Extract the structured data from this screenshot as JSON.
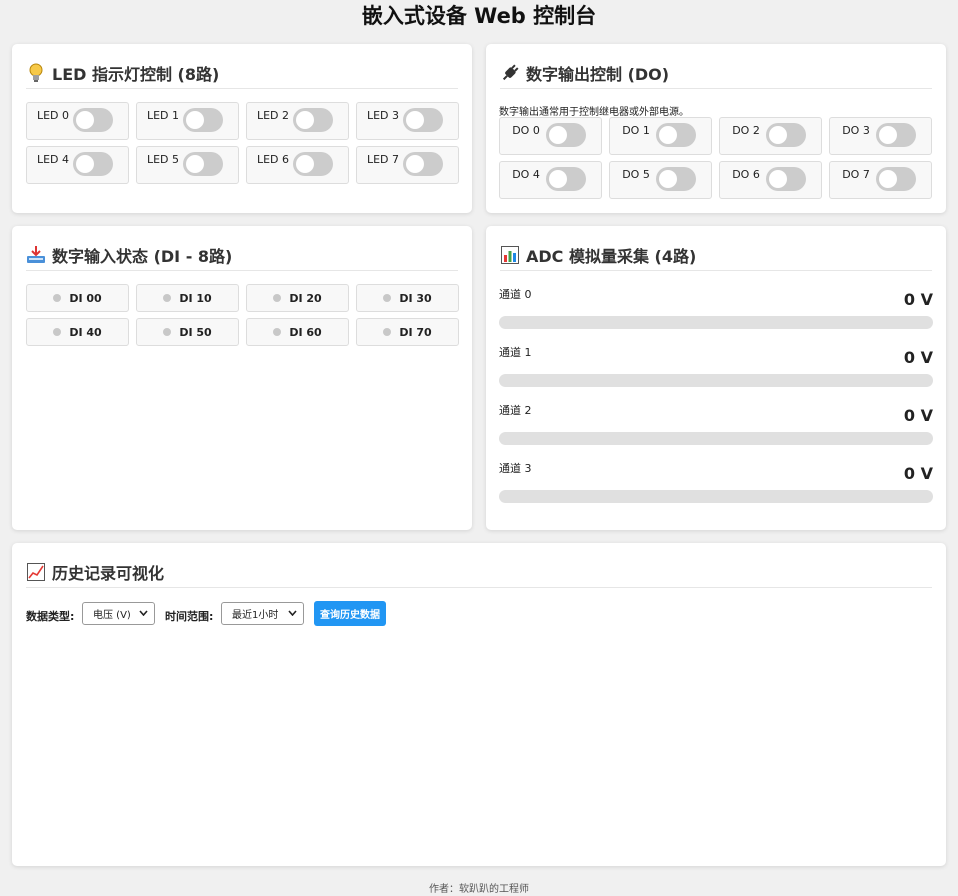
{
  "title": "嵌入式设备 Web 控制台",
  "led_panel": {
    "title": "LED 指示灯控制 (8路)",
    "icon": "lightbulb-icon",
    "items": [
      {
        "label": "LED 0",
        "on": false
      },
      {
        "label": "LED 1",
        "on": false
      },
      {
        "label": "LED 2",
        "on": false
      },
      {
        "label": "LED 3",
        "on": false
      },
      {
        "label": "LED 4",
        "on": false
      },
      {
        "label": "LED 5",
        "on": false
      },
      {
        "label": "LED 6",
        "on": false
      },
      {
        "label": "LED 7",
        "on": false
      }
    ]
  },
  "do_panel": {
    "title": "数字输出控制 (DO)",
    "icon": "plug-icon",
    "description": "数字输出通常用于控制继电器或外部电源。",
    "items": [
      {
        "label": "DO 0",
        "on": false
      },
      {
        "label": "DO 1",
        "on": false
      },
      {
        "label": "DO 2",
        "on": false
      },
      {
        "label": "DO 3",
        "on": false
      },
      {
        "label": "DO 4",
        "on": false
      },
      {
        "label": "DO 5",
        "on": false
      },
      {
        "label": "DO 6",
        "on": false
      },
      {
        "label": "DO 7",
        "on": false
      }
    ]
  },
  "di_panel": {
    "title": "数字输入状态 (DI - 8路)",
    "icon": "input-tray-icon",
    "items": [
      {
        "label": "DI 0",
        "value": "0"
      },
      {
        "label": "DI 1",
        "value": "0"
      },
      {
        "label": "DI 2",
        "value": "0"
      },
      {
        "label": "DI 3",
        "value": "0"
      },
      {
        "label": "DI 4",
        "value": "0"
      },
      {
        "label": "DI 5",
        "value": "0"
      },
      {
        "label": "DI 6",
        "value": "0"
      },
      {
        "label": "DI 7",
        "value": "0"
      }
    ]
  },
  "adc_panel": {
    "title": "ADC 模拟量采集 (4路)",
    "icon": "bar-chart-icon",
    "channels": [
      {
        "label": "通道 0",
        "value": "0 V",
        "level": 0
      },
      {
        "label": "通道 1",
        "value": "0 V",
        "level": 0
      },
      {
        "label": "通道 2",
        "value": "0 V",
        "level": 0
      },
      {
        "label": "通道 3",
        "value": "0 V",
        "level": 0
      }
    ]
  },
  "history_panel": {
    "title": "历史记录可视化",
    "icon": "line-chart-icon",
    "data_type_label": "数据类型:",
    "data_type_value": "电压 (V)",
    "time_range_label": "时间范围:",
    "time_range_value": "最近1小时",
    "query_button": "查询历史数据"
  },
  "colors": {
    "accent": "#2196f3",
    "toggle_off": "#cccccc",
    "background": "#f0f0f0"
  },
  "footer": "作者：软趴趴的工程师"
}
